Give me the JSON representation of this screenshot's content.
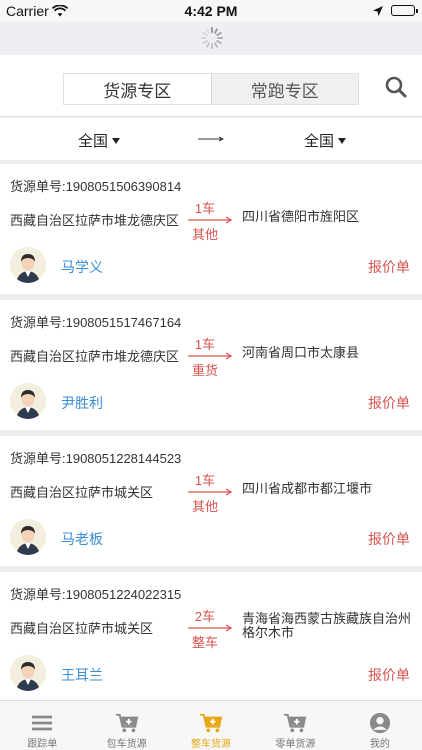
{
  "status": {
    "carrier": "Carrier",
    "time": "4:42 PM"
  },
  "header": {
    "tabs": [
      {
        "label": "货源专区",
        "active": true
      },
      {
        "label": "常跑专区",
        "active": false
      }
    ]
  },
  "filter": {
    "from": "全国",
    "to": "全国"
  },
  "orders": [
    {
      "no": "货源单号:1908051506390814",
      "origin": "西藏自治区拉萨市堆龙德庆区",
      "count": "1车",
      "cargo": "其他",
      "dest": "四川省德阳市旌阳区",
      "user": "马学义",
      "quote": "报价单"
    },
    {
      "no": "货源单号:1908051517467164",
      "origin": "西藏自治区拉萨市堆龙德庆区",
      "count": "1车",
      "cargo": "重货",
      "dest": "河南省周口市太康县",
      "user": "尹胜利",
      "quote": "报价单"
    },
    {
      "no": "货源单号:1908051228144523",
      "origin": "西藏自治区拉萨市城关区",
      "count": "1车",
      "cargo": "其他",
      "dest": "四川省成都市都江堰市",
      "user": "马老板",
      "quote": "报价单"
    },
    {
      "no": "货源单号:1908051224022315",
      "origin": "西藏自治区拉萨市城关区",
      "count": "2车",
      "cargo": "整车",
      "dest": "青海省海西蒙古族藏族自治州格尔木市",
      "user": "王耳兰",
      "quote": "报价单"
    }
  ],
  "tabbar": [
    {
      "label": "跟踪单",
      "icon": "menu-icon",
      "active": false
    },
    {
      "label": "包车货源",
      "icon": "cart-plus-icon",
      "active": false
    },
    {
      "label": "整车货源",
      "icon": "cart-plus-icon",
      "active": true
    },
    {
      "label": "零单货源",
      "icon": "cart-plus-icon",
      "active": false
    },
    {
      "label": "我的",
      "icon": "user-icon",
      "active": false
    }
  ],
  "colors": {
    "accent": "#e6a817",
    "link": "#3a8fd6",
    "alert": "#d9534f"
  }
}
